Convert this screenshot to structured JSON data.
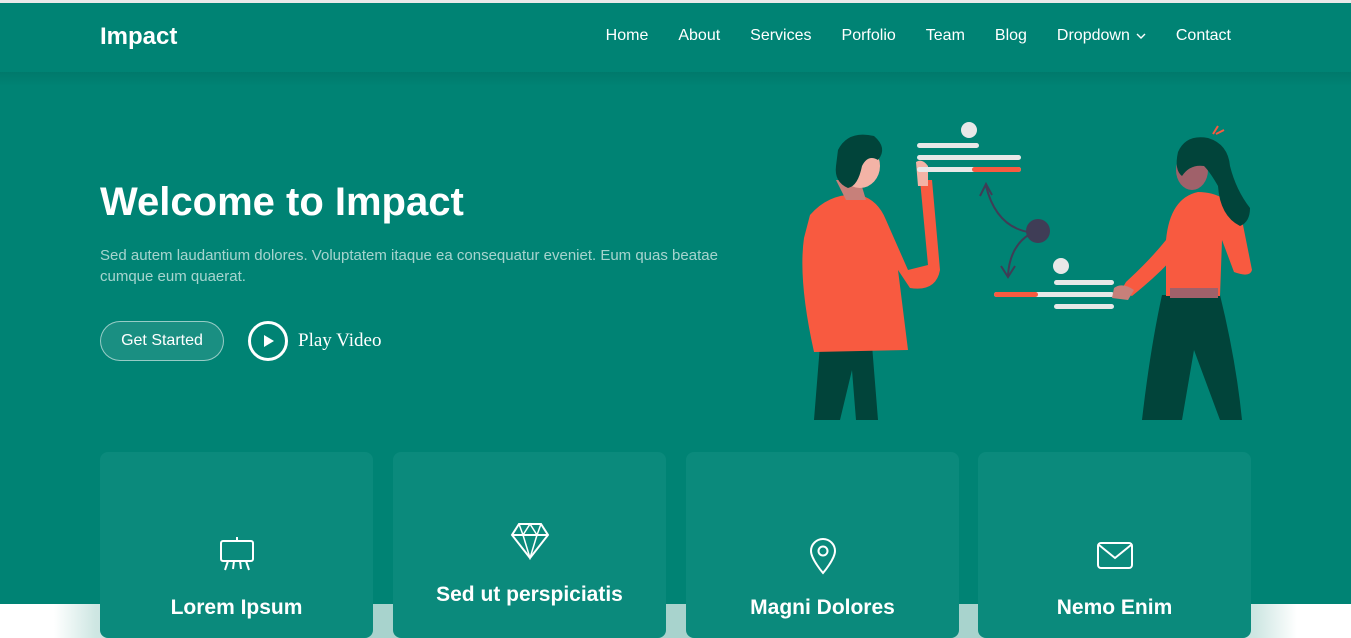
{
  "header": {
    "logo": "Impact",
    "nav": [
      {
        "label": "Home"
      },
      {
        "label": "About"
      },
      {
        "label": "Services"
      },
      {
        "label": "Porfolio"
      },
      {
        "label": "Team"
      },
      {
        "label": "Blog"
      },
      {
        "label": "Dropdown",
        "icon": "chevron-down-icon"
      },
      {
        "label": "Contact"
      }
    ]
  },
  "hero": {
    "title": "Welcome to Impact",
    "subtitle": "Sed autem laudantium dolores. Voluptatem itaque ea consequatur eveniet. Eum quas beatae cumque eum quaerat.",
    "get_started": "Get Started",
    "play_video": "Play Video"
  },
  "cards": [
    {
      "title": "Lorem Ipsum",
      "icon": "easel-icon"
    },
    {
      "title": "Sed ut perspiciatis",
      "icon": "gem-icon"
    },
    {
      "title": "Magni Dolores",
      "icon": "geo-pin-icon"
    },
    {
      "title": "Nemo Enim",
      "icon": "envelope-icon"
    }
  ],
  "colors": {
    "brand": "#008374",
    "card": "#0b8a7c",
    "accent": "#f85a40",
    "dark_green": "#01443a"
  }
}
